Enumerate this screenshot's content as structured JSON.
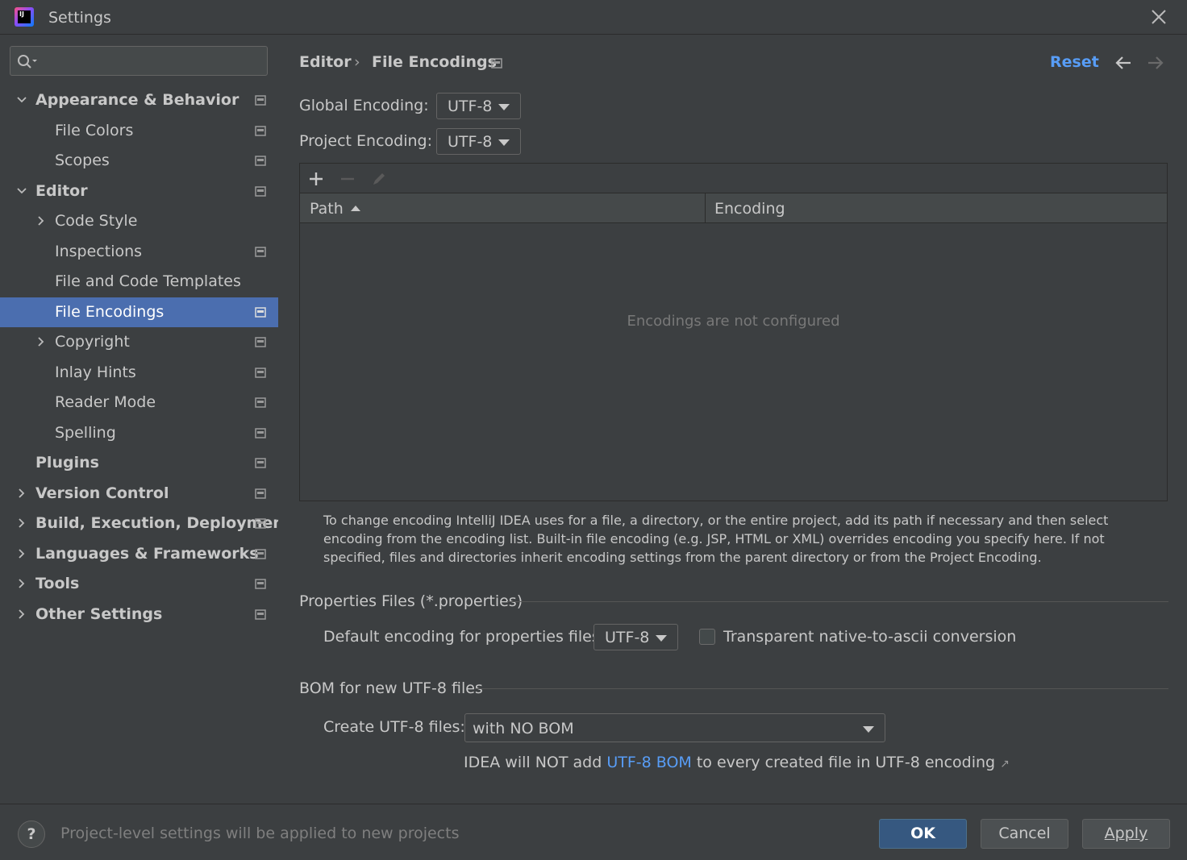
{
  "window": {
    "title": "Settings",
    "app_logo_text": "IJ"
  },
  "search": {
    "placeholder": ""
  },
  "sidebar": {
    "items": [
      {
        "label": "Appearance & Behavior",
        "bold": true,
        "arrow": "expanded",
        "level": 0,
        "project_icon": true
      },
      {
        "label": "File Colors",
        "bold": false,
        "arrow": "none",
        "level": 1,
        "project_icon": true
      },
      {
        "label": "Scopes",
        "bold": false,
        "arrow": "none",
        "level": 1,
        "project_icon": true
      },
      {
        "label": "Editor",
        "bold": true,
        "arrow": "expanded",
        "level": 0,
        "project_icon": true
      },
      {
        "label": "Code Style",
        "bold": false,
        "arrow": "collapsed",
        "level": 1,
        "project_icon": false
      },
      {
        "label": "Inspections",
        "bold": false,
        "arrow": "none",
        "level": 1,
        "project_icon": true
      },
      {
        "label": "File and Code Templates",
        "bold": false,
        "arrow": "none",
        "level": 1,
        "project_icon": false
      },
      {
        "label": "File Encodings",
        "bold": false,
        "arrow": "none",
        "level": 1,
        "project_icon": true,
        "selected": true
      },
      {
        "label": "Copyright",
        "bold": false,
        "arrow": "collapsed",
        "level": 1,
        "project_icon": true
      },
      {
        "label": "Inlay Hints",
        "bold": false,
        "arrow": "none",
        "level": 1,
        "project_icon": true
      },
      {
        "label": "Reader Mode",
        "bold": false,
        "arrow": "none",
        "level": 1,
        "project_icon": true
      },
      {
        "label": "Spelling",
        "bold": false,
        "arrow": "none",
        "level": 1,
        "project_icon": true
      },
      {
        "label": "Plugins",
        "bold": true,
        "arrow": "none",
        "level": 0,
        "project_icon": true
      },
      {
        "label": "Version Control",
        "bold": true,
        "arrow": "collapsed",
        "level": 0,
        "project_icon": true
      },
      {
        "label": "Build, Execution, Deployment",
        "bold": true,
        "arrow": "collapsed",
        "level": 0,
        "project_icon": true
      },
      {
        "label": "Languages & Frameworks",
        "bold": true,
        "arrow": "collapsed",
        "level": 0,
        "project_icon": true
      },
      {
        "label": "Tools",
        "bold": true,
        "arrow": "collapsed",
        "level": 0,
        "project_icon": true
      },
      {
        "label": "Other Settings",
        "bold": true,
        "arrow": "collapsed",
        "level": 0,
        "project_icon": true
      }
    ]
  },
  "breadcrumb": {
    "parent": "Editor",
    "separator": "›",
    "current": "File Encodings"
  },
  "header": {
    "reset_label": "Reset"
  },
  "encodings": {
    "global_label": "Global Encoding:",
    "global_value": "UTF-8",
    "project_label": "Project Encoding:",
    "project_value": "UTF-8"
  },
  "table": {
    "columns": [
      "Path",
      "Encoding"
    ],
    "sort_column": "Path",
    "empty_text": "Encodings are not configured"
  },
  "help_text": "To change encoding IntelliJ IDEA uses for a file, a directory, or the entire project, add its path if necessary and then select encoding from the encoding list. Built-in file encoding (e.g. JSP, HTML or XML) overrides encoding you specify here. If not specified, files and directories inherit encoding settings from the parent directory or from the Project Encoding.",
  "properties": {
    "section_title": "Properties Files (*.properties)",
    "default_label": "Default encoding for properties files:",
    "default_value": "UTF-8",
    "checkbox_label": "Transparent native-to-ascii conversion",
    "checkbox_checked": false
  },
  "bom": {
    "section_title": "BOM for new UTF-8 files",
    "create_label": "Create UTF-8 files:",
    "create_value": "with NO BOM",
    "note_prefix": "IDEA will NOT add ",
    "note_link": "UTF-8 BOM",
    "note_suffix": " to every created file in UTF-8 encoding",
    "note_arrow": "↗"
  },
  "footer": {
    "help_symbol": "?",
    "text": "Project-level settings will be applied to new projects",
    "ok_label": "OK",
    "cancel_label": "Cancel",
    "apply_label": "Apply"
  },
  "colors": {
    "background": "#3c3f41",
    "selection": "#4b6eaf",
    "link": "#589df6",
    "primary_button": "#365880"
  }
}
